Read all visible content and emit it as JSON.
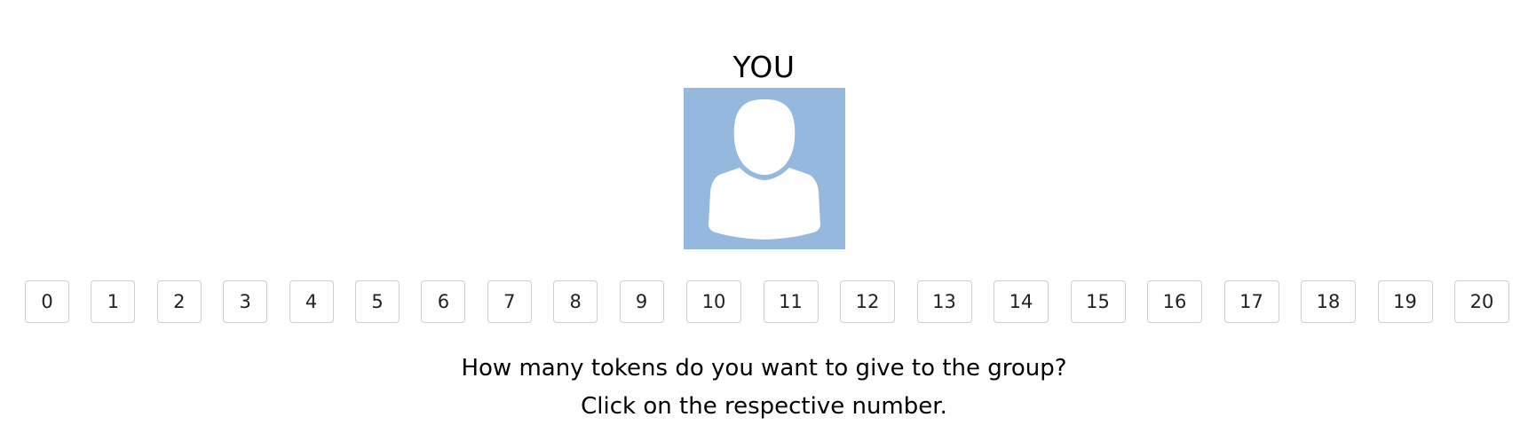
{
  "player": {
    "label": "YOU",
    "avatar_icon": "person-silhouette-icon",
    "avatar_bg_color": "#95b9de"
  },
  "tokens": {
    "options": [
      "0",
      "1",
      "2",
      "3",
      "4",
      "5",
      "6",
      "7",
      "8",
      "9",
      "10",
      "11",
      "12",
      "13",
      "14",
      "15",
      "16",
      "17",
      "18",
      "19",
      "20"
    ]
  },
  "prompt": {
    "question": "How many tokens do you want to give to the group?",
    "instruction": "Click on the respective number."
  }
}
